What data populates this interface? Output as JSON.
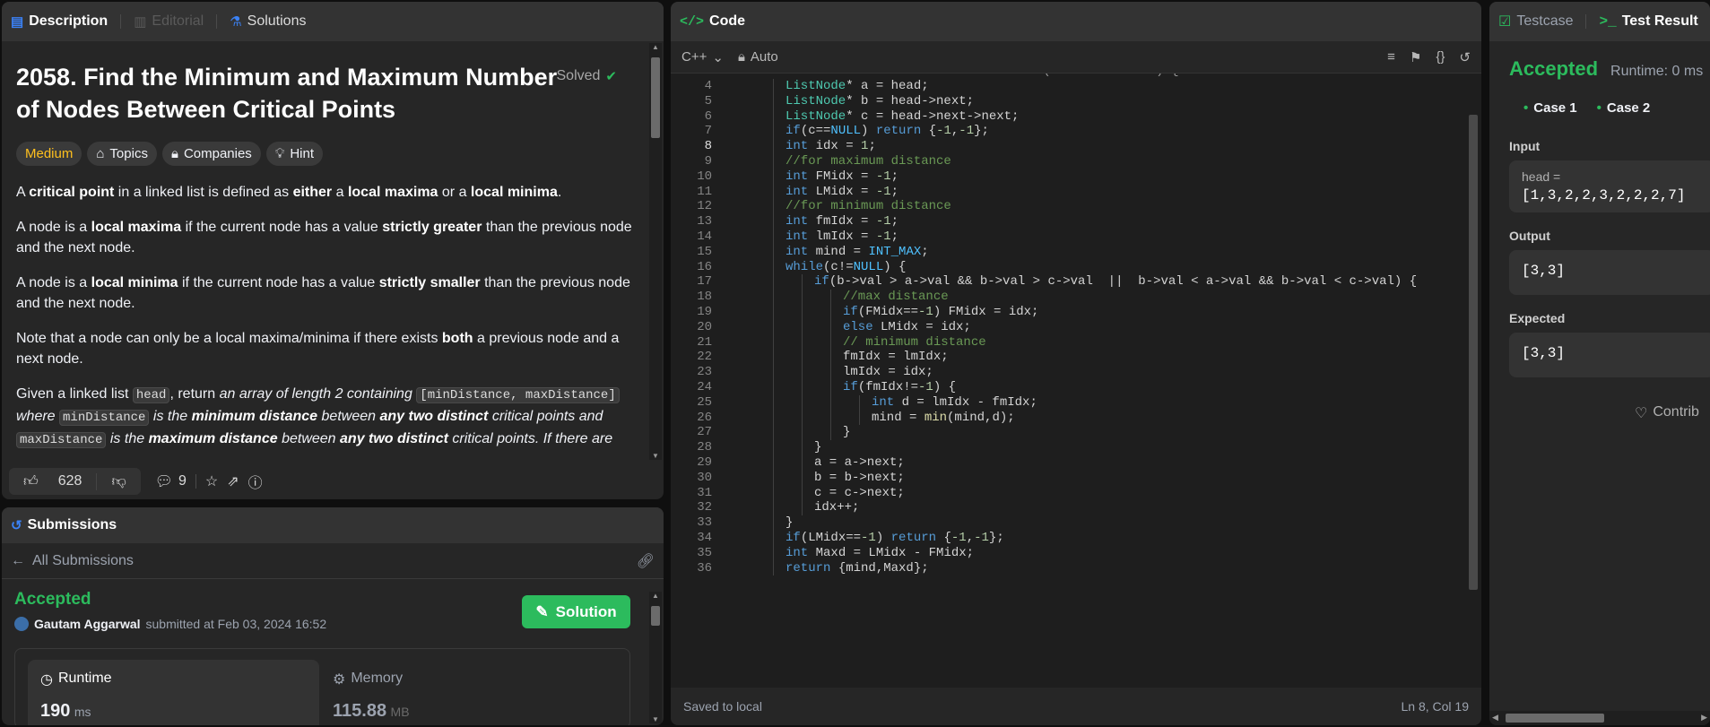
{
  "description_panel": {
    "tabs": [
      {
        "label": "Description",
        "active": true
      },
      {
        "label": "Editorial",
        "active": false
      },
      {
        "label": "Solutions",
        "active": false
      }
    ],
    "title": "2058. Find the Minimum and Maximum Number of Nodes Between Critical Points",
    "solved_label": "Solved",
    "tags": [
      "Medium",
      "Topics",
      "Companies",
      "Hint"
    ],
    "p1": {
      "a": "A ",
      "b1": "critical point",
      "c": " in a linked list is defined as ",
      "b2": "either",
      "d": " a ",
      "b3": "local maxima",
      "e": " or a ",
      "b4": "local minima",
      "f": "."
    },
    "p2": {
      "a": "A node is a ",
      "b1": "local maxima",
      "c": " if the current node has a value ",
      "b2": "strictly greater",
      "d": " than the previous node and the next node."
    },
    "p3": {
      "a": "A node is a ",
      "b1": "local minima",
      "c": " if the current node has a value ",
      "b2": "strictly smaller",
      "d": " than the previous node and the next node."
    },
    "p4": {
      "a": "Note that a node can only be a local maxima/minima if there exists ",
      "b1": "both",
      "c": " a previous node and a next node."
    },
    "p5": {
      "a": "Given a linked list ",
      "c1": "head",
      "b": ", return ",
      "i1": "an array of length 2 containing ",
      "c2": "[minDistance, maxDistance]",
      "i2": " where ",
      "c3": "minDistance",
      "i3": " is the ",
      "b1": "minimum distance",
      "i4": " between ",
      "b2": "any two distinct",
      "i5": " critical points and ",
      "c4": "maxDistance",
      "i6": " is the ",
      "b3": "maximum distance",
      "i7": " between ",
      "b4": "any two distinct",
      "i8": " critical points. If there are"
    },
    "likes": "628",
    "comments": "9"
  },
  "submissions_panel": {
    "title": "Submissions",
    "back_label": "All Submissions",
    "status": "Accepted",
    "author": "Gautam Aggarwal",
    "submitted_text": "submitted at Feb 03, 2024 16:52",
    "solution_button": "Solution",
    "runtime_label": "Runtime",
    "runtime_value": "190",
    "runtime_unit": "ms",
    "memory_label": "Memory",
    "memory_value": "115.88",
    "memory_unit": "MB"
  },
  "code_panel": {
    "title": "Code",
    "language": "C++",
    "autosave_mode": "Auto",
    "status_left": "Saved to local",
    "cursor_pos": "Ln 8, Col 19",
    "current_line": "8",
    "lines": [
      {
        "n": "4",
        "text": "ListNode* a = head;"
      },
      {
        "n": "5",
        "text": "ListNode* b = head->next;"
      },
      {
        "n": "6",
        "text": "ListNode* c = head->next->next;"
      },
      {
        "n": "7",
        "text": "if(c==NULL) return {-1,-1};"
      },
      {
        "n": "8",
        "text": "int idx = 1;"
      },
      {
        "n": "9",
        "text": "//for maximum distance"
      },
      {
        "n": "10",
        "text": "int FMidx = -1;"
      },
      {
        "n": "11",
        "text": "int LMidx = -1;"
      },
      {
        "n": "12",
        "text": "//for minimum distance"
      },
      {
        "n": "13",
        "text": "int fmIdx = -1;"
      },
      {
        "n": "14",
        "text": "int lmIdx = -1;"
      },
      {
        "n": "15",
        "text": "int mind = INT_MAX;"
      },
      {
        "n": "16",
        "text": "while(c!=NULL) {"
      },
      {
        "n": "17",
        "text": "if(b->val > a->val && b->val > c->val  ||  b->val < a->val && b->val < c->val) {"
      },
      {
        "n": "18",
        "text": "//max distance"
      },
      {
        "n": "19",
        "text": "if(FMidx==-1) FMidx = idx;"
      },
      {
        "n": "20",
        "text": "else LMidx = idx;"
      },
      {
        "n": "21",
        "text": "// minimum distance"
      },
      {
        "n": "22",
        "text": "fmIdx = lmIdx;"
      },
      {
        "n": "23",
        "text": "lmIdx = idx;"
      },
      {
        "n": "24",
        "text": "if(fmIdx!=-1) {"
      },
      {
        "n": "25",
        "text": "int d = lmIdx - fmIdx;"
      },
      {
        "n": "26",
        "text": "mind = min(mind,d);"
      },
      {
        "n": "27",
        "text": "}"
      },
      {
        "n": "28",
        "text": "}"
      },
      {
        "n": "29",
        "text": "a = a->next;"
      },
      {
        "n": "30",
        "text": "b = b->next;"
      },
      {
        "n": "31",
        "text": "c = c->next;"
      },
      {
        "n": "32",
        "text": "idx++;"
      },
      {
        "n": "33",
        "text": "}"
      },
      {
        "n": "34",
        "text": "if(LMidx==-1) return {-1,-1};"
      },
      {
        "n": "35",
        "text": "int Maxd = LMidx - FMidx;"
      },
      {
        "n": "36",
        "text": "return {mind,Maxd};"
      }
    ]
  },
  "test_panel": {
    "tabs": [
      {
        "label": "Testcase",
        "active": false
      },
      {
        "label": "Test Result",
        "active": true
      }
    ],
    "status": "Accepted",
    "runtime": "Runtime: 0 ms",
    "cases": [
      "Case 1",
      "Case 2"
    ],
    "input_label": "Input",
    "input_var": "head =",
    "input_value": "[1,3,2,2,3,2,2,2,7]",
    "output_label": "Output",
    "output_value": "[3,3]",
    "expected_label": "Expected",
    "expected_value": "[3,3]",
    "contribute_label": "Contrib"
  },
  "colors": {
    "accent_green": "#2cbb5d",
    "medium": "#ffc01e",
    "bg": "#0f0f0f",
    "panel": "#262626"
  }
}
